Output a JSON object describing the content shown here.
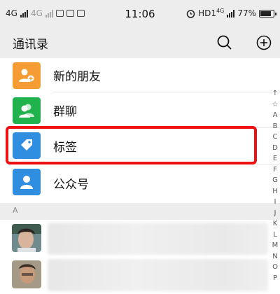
{
  "status_bar": {
    "left_network_1": "4G",
    "left_network_2": "4G",
    "time": "11:06",
    "right_network": "HD1",
    "right_network_sup": "4G",
    "battery": "77%"
  },
  "header": {
    "title": "通讯录"
  },
  "menu": {
    "items": [
      {
        "label": "新的朋友",
        "icon": "person-add-icon",
        "color": "#f59d34"
      },
      {
        "label": "群聊",
        "icon": "group-icon",
        "color": "#21b24d"
      },
      {
        "label": "标签",
        "icon": "tag-icon",
        "color": "#2f8ee0"
      },
      {
        "label": "公众号",
        "icon": "person-icon",
        "color": "#2f8ee0"
      }
    ]
  },
  "section": {
    "letter": "A"
  },
  "alphabet": [
    "↑",
    "☆",
    "A",
    "B",
    "C",
    "D",
    "E",
    "F",
    "G",
    "H",
    "I",
    "J",
    "K",
    "L",
    "M",
    "N",
    "O",
    "P"
  ],
  "highlight_color": "#ee1111"
}
